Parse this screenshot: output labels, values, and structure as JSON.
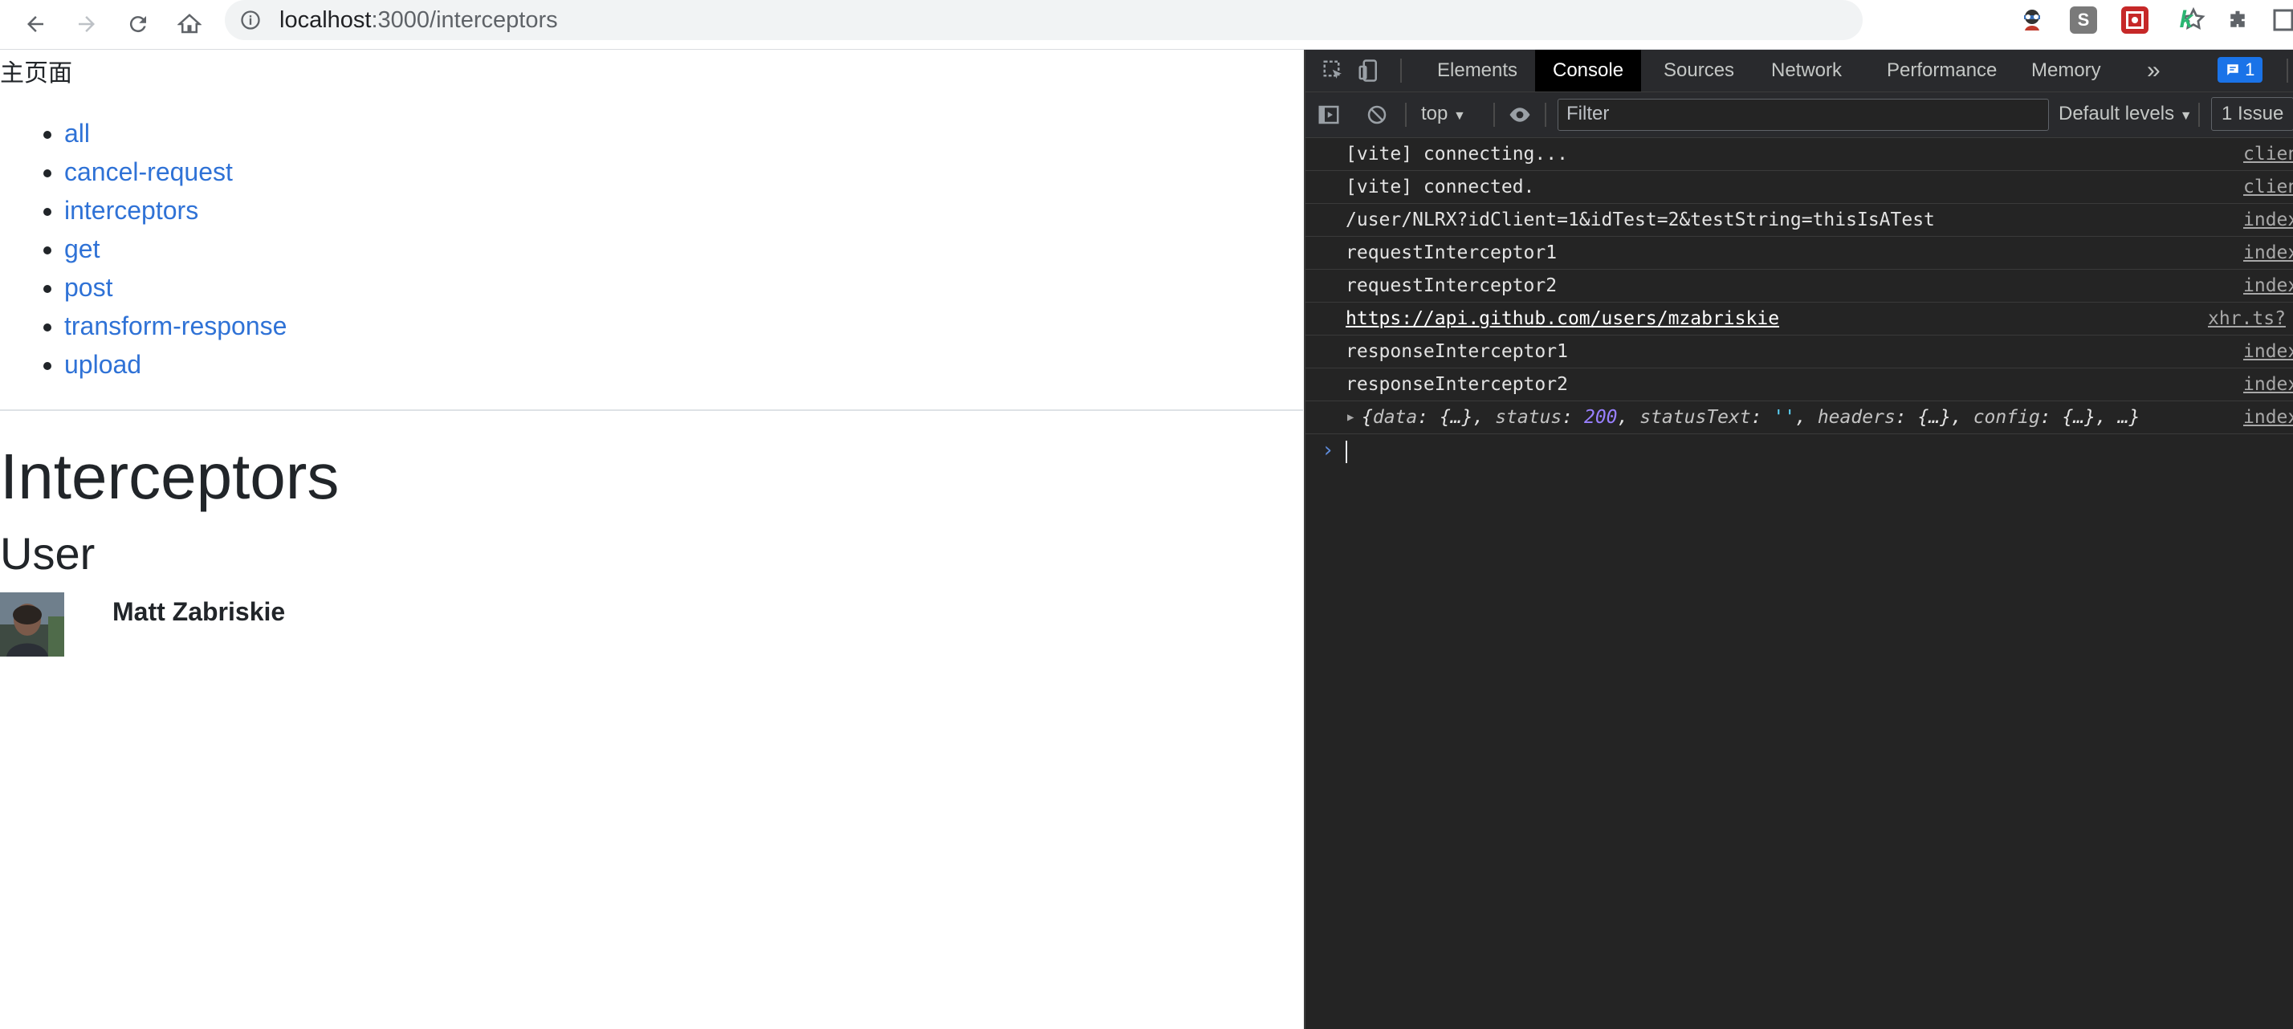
{
  "browser": {
    "url_host": "localhost",
    "url_path": ":3000/interceptors"
  },
  "page": {
    "home_link": "主页面",
    "nav": [
      {
        "label": "all"
      },
      {
        "label": "cancel-request"
      },
      {
        "label": "interceptors"
      },
      {
        "label": "get"
      },
      {
        "label": "post"
      },
      {
        "label": "transform-response"
      },
      {
        "label": "upload"
      }
    ],
    "heading": "Interceptors",
    "subheading": "User",
    "user_name": "Matt Zabriskie"
  },
  "devtools": {
    "tabs": [
      "Elements",
      "Console",
      "Sources",
      "Network",
      "Performance",
      "Memory"
    ],
    "active_tab": "Console",
    "more_tabs_glyph": "»",
    "message_count": "1",
    "context": "top",
    "filter_placeholder": "Filter",
    "levels": "Default levels",
    "issues": "1 Issue",
    "logs": [
      {
        "text": "[vite] connecting...",
        "source": "clien"
      },
      {
        "text": "[vite] connected.",
        "source": "clien"
      },
      {
        "text": "/user/NLRX?idClient=1&idTest=2&testString=thisIsATest",
        "source": "index"
      },
      {
        "text": "requestInterceptor1",
        "source": "index"
      },
      {
        "text": "requestInterceptor2",
        "source": "index"
      },
      {
        "text": "https://api.github.com/users/mzabriskie",
        "source": "xhr.ts?"
      },
      {
        "text": "responseInterceptor1",
        "source": "index"
      },
      {
        "text": "responseInterceptor2",
        "source": "index"
      }
    ],
    "object_log": {
      "source": "index",
      "status_value": "200",
      "statustext_value": "''"
    },
    "prompt": "›"
  },
  "colors": {
    "link": "#2f72d6",
    "devtools_bg": "#242424",
    "badge": "#1a73e8"
  }
}
